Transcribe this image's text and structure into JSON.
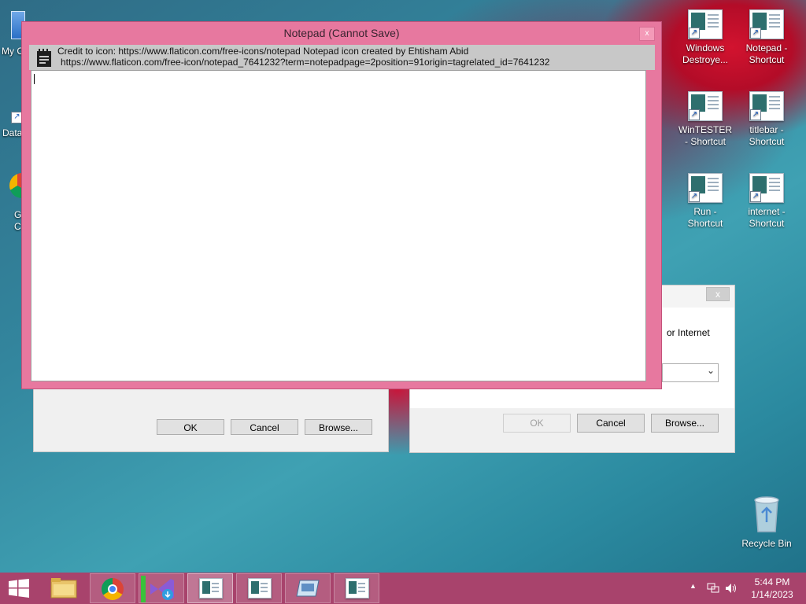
{
  "notepad": {
    "title": "Notepad (Cannot Save)",
    "credit_line1": "Credit to icon: https://www.flaticon.com/free-icons/notepad Notepad icon created by Ehtisham Abid",
    "credit_line2": "https://www.flaticon.com/free-icon/notepad_7641232?term=notepadpage=2position=91origin=tagrelated_id=7641232",
    "close_label": "x",
    "text": ""
  },
  "desktop_left": {
    "item1": "My C",
    "item2": "Data",
    "item3a": "G",
    "item3b": "C"
  },
  "desktop_icons": [
    {
      "label": "Windows Destroye..."
    },
    {
      "label": "Notepad - Shortcut"
    },
    {
      "label": "WinTESTER - Shortcut"
    },
    {
      "label": "titlebar - Shortcut"
    },
    {
      "label": "Run - Shortcut"
    },
    {
      "label": "internet - Shortcut"
    }
  ],
  "recycle_bin": {
    "label": "Recycle Bin"
  },
  "dialog_left": {
    "ok": "OK",
    "cancel": "Cancel",
    "browse": "Browse..."
  },
  "dialog_right": {
    "text": "or Internet",
    "ok": "OK",
    "cancel": "Cancel",
    "browse": "Browse...",
    "close_label": "x"
  },
  "taskbar": {
    "time": "5:44 PM",
    "date": "1/14/2023"
  },
  "colors": {
    "title_bar": "#e7789f",
    "taskbar": "#a8436c",
    "dialog": "#f0f0f0"
  }
}
